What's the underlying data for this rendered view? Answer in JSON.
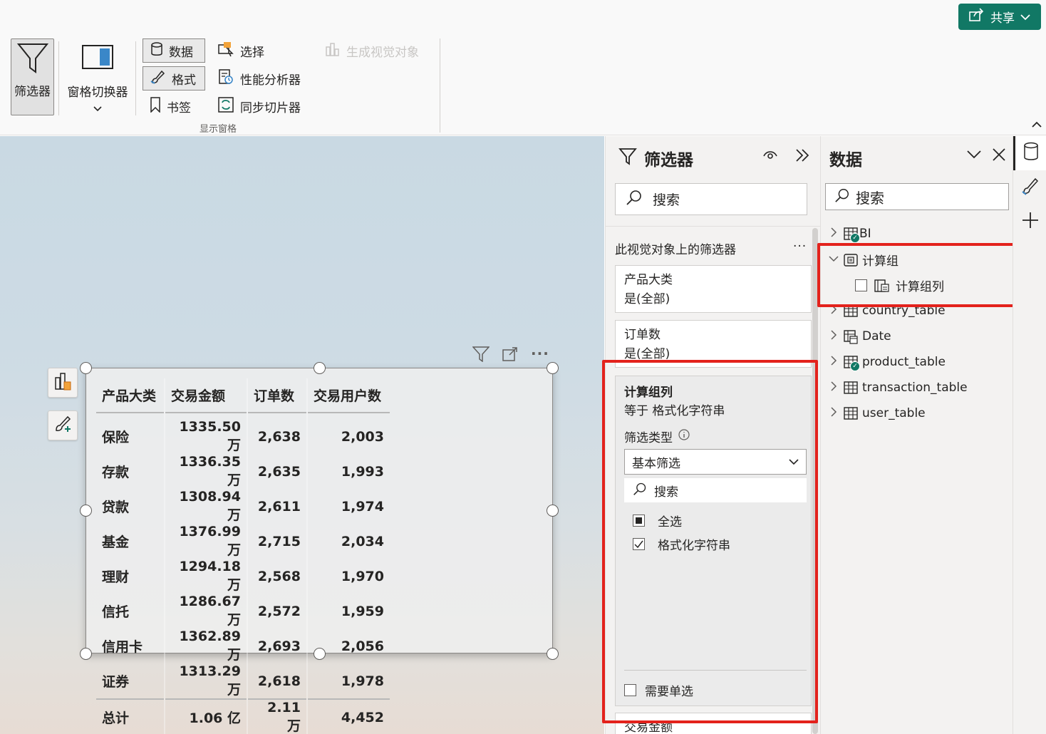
{
  "ribbon": {
    "share_label": "共享",
    "filter_label": "筛选器",
    "switcher_label": "窗格切换器",
    "data_label": "数据",
    "format_label": "格式",
    "bookmark_label": "书签",
    "select_label": "选择",
    "perf_label": "性能分析器",
    "sync_label": "同步切片器",
    "gen_visual_label": "生成视觉对象",
    "group_label": "显示窗格"
  },
  "visual": {
    "headers": [
      "产品大类",
      "交易金额",
      "订单数",
      "交易用户数"
    ],
    "rows": [
      [
        "保险",
        "1335.50 万",
        "2,638",
        "2,003"
      ],
      [
        "存款",
        "1336.35 万",
        "2,635",
        "1,993"
      ],
      [
        "贷款",
        "1308.94 万",
        "2,611",
        "1,974"
      ],
      [
        "基金",
        "1376.99 万",
        "2,715",
        "2,034"
      ],
      [
        "理财",
        "1294.18 万",
        "2,568",
        "1,970"
      ],
      [
        "信托",
        "1286.67 万",
        "2,572",
        "1,959"
      ],
      [
        "信用卡",
        "1362.89 万",
        "2,693",
        "2,056"
      ],
      [
        "证券",
        "1313.29 万",
        "2,618",
        "1,978"
      ]
    ],
    "total": [
      "总计",
      "1.06 亿",
      "2.11 万",
      "4,452"
    ]
  },
  "filter_pane": {
    "title": "筛选器",
    "search_placeholder": "搜索",
    "section_title": "此视觉对象上的筛选器",
    "more": "...",
    "cards": [
      {
        "field": "产品大类",
        "state": "是(全部)"
      },
      {
        "field": "订单数",
        "state": "是(全部)"
      }
    ],
    "active_card": {
      "field": "计算组列",
      "state": "等于 格式化字符串",
      "type_label": "筛选类型",
      "type_value": "基本筛选",
      "search_placeholder": "搜索",
      "select_all": "全选",
      "option": "格式化字符串",
      "require_single": "需要单选"
    },
    "next_card_field": "交易金额"
  },
  "data_pane": {
    "title": "数据",
    "search_placeholder": "搜索",
    "items": [
      {
        "name": "BI"
      },
      {
        "name": "计算组"
      },
      {
        "name": "计算组列"
      },
      {
        "name": "country_table"
      },
      {
        "name": "Date"
      },
      {
        "name": "product_table"
      },
      {
        "name": "transaction_table"
      },
      {
        "name": "user_table"
      }
    ]
  },
  "colors": {
    "accent": "#117865",
    "highlight": "#e3221c"
  }
}
